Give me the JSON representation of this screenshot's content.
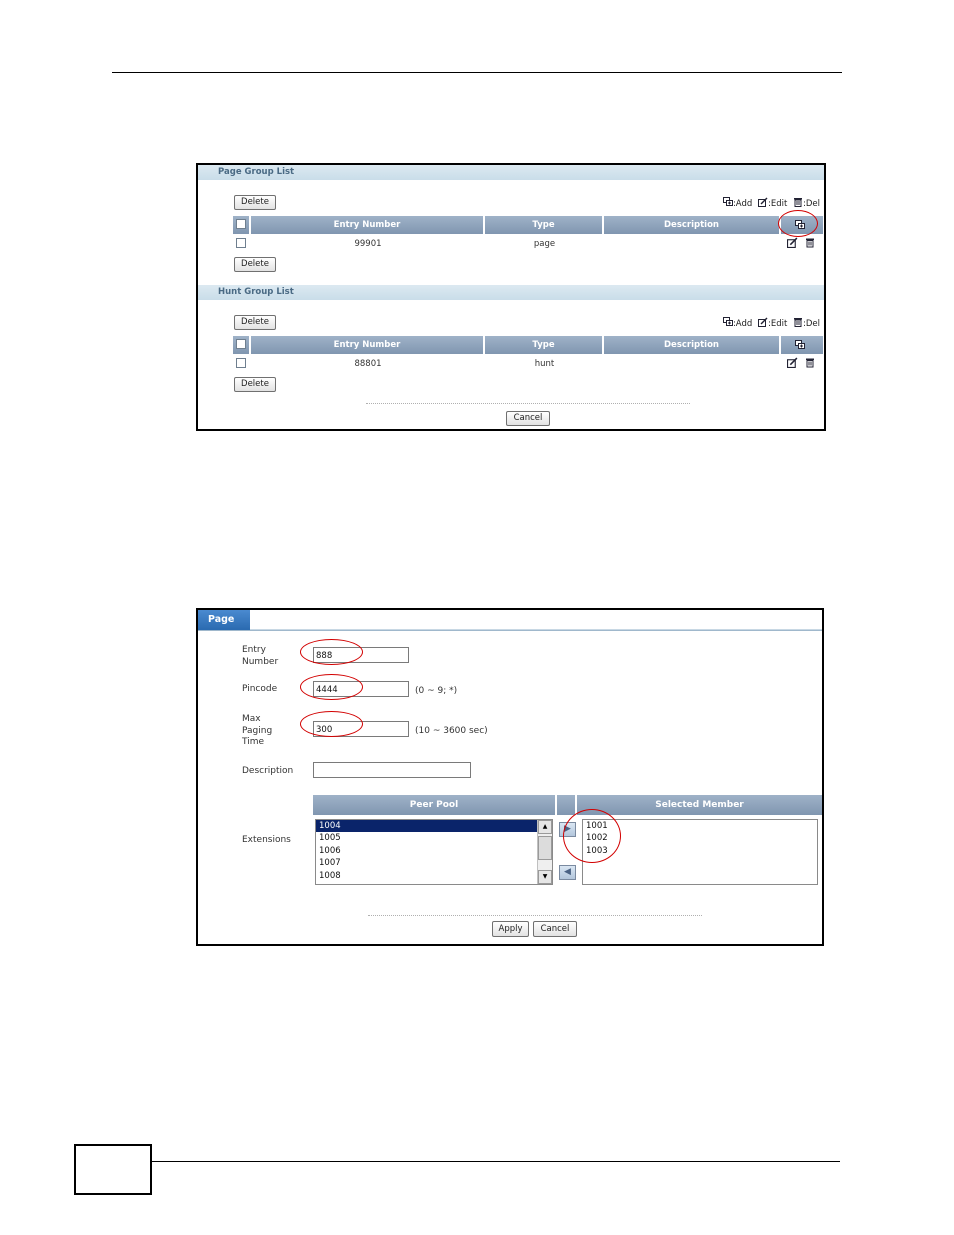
{
  "page_groups": {
    "title": "Page Group List",
    "delete_label": "Delete",
    "legend": {
      "add": ":Add",
      "edit": ":Edit",
      "del": ":Del"
    },
    "columns": [
      "Entry Number",
      "Type",
      "Description"
    ],
    "rows": [
      {
        "entry_number": "99901",
        "type": "page",
        "description": ""
      }
    ]
  },
  "hunt_groups": {
    "title": "Hunt Group List",
    "delete_label": "Delete",
    "legend": {
      "add": ":Add",
      "edit": ":Edit",
      "del": ":Del"
    },
    "columns": [
      "Entry Number",
      "Type",
      "Description"
    ],
    "rows": [
      {
        "entry_number": "88801",
        "type": "hunt",
        "description": ""
      }
    ]
  },
  "list_cancel_label": "Cancel",
  "page_form": {
    "tab": "Page",
    "entry_number_label_1": "Entry",
    "entry_number_label_2": "Number",
    "entry_number_value": "888",
    "pincode_label": "Pincode",
    "pincode_value": "4444",
    "pincode_hint": "(0 ~ 9; *)",
    "paging_label_1": "Max",
    "paging_label_2": "Paging",
    "paging_label_3": "Time",
    "paging_value": "300",
    "paging_hint": "(10 ~ 3600 sec)",
    "description_label": "Description",
    "description_value": "",
    "extensions_label": "Extensions",
    "peer_pool_header": "Peer Pool",
    "selected_member_header": "Selected Member",
    "peer_pool": [
      "1004",
      "1005",
      "1006",
      "1007",
      "1008"
    ],
    "selected_members": [
      "1001",
      "1002",
      "1003"
    ],
    "apply_label": "Apply",
    "cancel_label": "Cancel"
  },
  "colors": {
    "annotation": "#d20000",
    "header": "#8fa4bc",
    "tab": "#3a7ac0",
    "selection": "#0a246a"
  }
}
